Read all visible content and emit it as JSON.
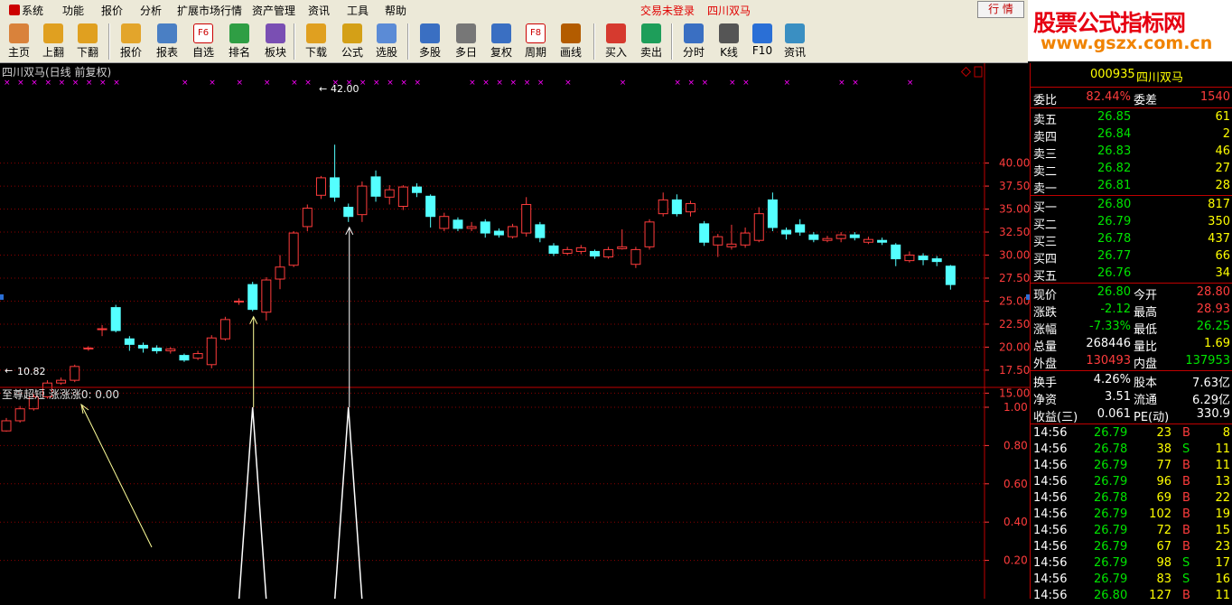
{
  "menu": {
    "items": [
      "系统",
      "功能",
      "报价",
      "分析",
      "扩展市场行情",
      "资产管理",
      "资讯",
      "工具",
      "帮助"
    ],
    "trade_status": "交易未登录",
    "stock_name": "四川双马",
    "hq_button": "行  情"
  },
  "watermark": {
    "line1": "股票公式指标网",
    "line2": "www.gszx.com.cn"
  },
  "toolbar": {
    "buttons": [
      {
        "label": "主页",
        "icon": "home-icon"
      },
      {
        "label": "上翻",
        "icon": "arrow-up-icon"
      },
      {
        "label": "下翻",
        "icon": "arrow-down-icon"
      },
      {
        "label": "报价",
        "icon": "yuan-icon"
      },
      {
        "label": "报表",
        "icon": "report-icon"
      },
      {
        "label": "自选",
        "icon": "f6-icon"
      },
      {
        "label": "排名",
        "icon": "rank-icon"
      },
      {
        "label": "板块",
        "icon": "blocks-icon"
      },
      {
        "label": "下载",
        "icon": "download-icon"
      },
      {
        "label": "公式",
        "icon": "formula-icon"
      },
      {
        "label": "选股",
        "icon": "select-stock-icon"
      },
      {
        "label": "多股",
        "icon": "multi-stock-icon"
      },
      {
        "label": "多日",
        "icon": "clock-icon"
      },
      {
        "label": "复权",
        "icon": "adjust-icon"
      },
      {
        "label": "周期",
        "icon": "f8-icon"
      },
      {
        "label": "画线",
        "icon": "pen-icon"
      },
      {
        "label": "买入",
        "icon": "buy-icon"
      },
      {
        "label": "卖出",
        "icon": "sell-icon"
      },
      {
        "label": "分时",
        "icon": "intraday-icon"
      },
      {
        "label": "K线",
        "icon": "kline-icon"
      },
      {
        "label": "F10",
        "icon": "f10-icon"
      },
      {
        "label": "资讯",
        "icon": "news-icon"
      }
    ],
    "f6_text": "F6",
    "f8_text": "F8"
  },
  "chart": {
    "title": "四川双马(日线 前复权)",
    "high_label": "42.00",
    "low_label": "10.82",
    "price_axis": [
      "40.00",
      "37.50",
      "35.00",
      "32.50",
      "30.00",
      "27.50",
      "25.00",
      "22.50",
      "20.00",
      "17.50",
      "15.00"
    ],
    "indicator_title": "至尊超短  涨涨涨0: 0.00",
    "indicator_axis": [
      "1.00",
      "0.80",
      "0.60",
      "0.40",
      "0.20"
    ],
    "colors": {
      "up": "#ff3c3c",
      "down": "#54ffff",
      "ma": "#ffffff",
      "grid": "#8b0000",
      "axis": "#ff3c3c",
      "marker": "#ff00ff"
    }
  },
  "chart_data": {
    "type": "candlestick",
    "title": "四川双马(日线 前复权)",
    "ylim": [
      10,
      42.5
    ],
    "candles": [
      {
        "o": 10.9,
        "c": 12.0,
        "h": 12.3,
        "l": 10.82
      },
      {
        "o": 12.0,
        "c": 13.3,
        "h": 13.6,
        "l": 11.8
      },
      {
        "o": 13.3,
        "c": 14.6,
        "h": 14.9,
        "l": 13.1
      },
      {
        "o": 14.6,
        "c": 16.1,
        "h": 16.4,
        "l": 14.4
      },
      {
        "o": 16.1,
        "c": 16.4,
        "h": 16.7,
        "l": 15.9
      },
      {
        "o": 16.4,
        "c": 17.9,
        "h": 18.1,
        "l": 16.2
      },
      {
        "o": 19.8,
        "c": 19.9,
        "h": 20.1,
        "l": 19.6
      },
      {
        "o": 21.9,
        "c": 22.0,
        "h": 22.4,
        "l": 21.2
      },
      {
        "o": 24.3,
        "c": 21.8,
        "h": 24.6,
        "l": 21.6
      },
      {
        "o": 20.9,
        "c": 20.3,
        "h": 21.2,
        "l": 19.6
      },
      {
        "o": 20.2,
        "c": 19.9,
        "h": 20.5,
        "l": 19.4
      },
      {
        "o": 19.9,
        "c": 19.6,
        "h": 20.2,
        "l": 19.3
      },
      {
        "o": 19.6,
        "c": 19.8,
        "h": 20.0,
        "l": 19.3
      },
      {
        "o": 19.1,
        "c": 18.6,
        "h": 19.3,
        "l": 18.4
      },
      {
        "o": 18.8,
        "c": 19.3,
        "h": 19.6,
        "l": 18.6
      },
      {
        "o": 18.1,
        "c": 21.0,
        "h": 21.3,
        "l": 17.7
      },
      {
        "o": 20.9,
        "c": 23.0,
        "h": 23.3,
        "l": 20.7
      },
      {
        "o": 24.9,
        "c": 25.0,
        "h": 25.3,
        "l": 24.6
      },
      {
        "o": 26.8,
        "c": 24.1,
        "h": 27.1,
        "l": 23.9
      },
      {
        "o": 23.8,
        "c": 27.3,
        "h": 27.6,
        "l": 22.9
      },
      {
        "o": 27.4,
        "c": 28.7,
        "h": 30.0,
        "l": 26.3
      },
      {
        "o": 28.9,
        "c": 32.4,
        "h": 32.6,
        "l": 28.7
      },
      {
        "o": 33.1,
        "c": 35.1,
        "h": 35.5,
        "l": 32.6
      },
      {
        "o": 36.5,
        "c": 38.4,
        "h": 38.6,
        "l": 36.1
      },
      {
        "o": 38.4,
        "c": 36.3,
        "h": 42.0,
        "l": 35.8
      },
      {
        "o": 35.2,
        "c": 34.2,
        "h": 35.6,
        "l": 33.6
      },
      {
        "o": 34.4,
        "c": 37.5,
        "h": 38.0,
        "l": 33.6
      },
      {
        "o": 38.5,
        "c": 36.4,
        "h": 39.2,
        "l": 35.8
      },
      {
        "o": 36.3,
        "c": 37.1,
        "h": 37.6,
        "l": 35.5
      },
      {
        "o": 35.3,
        "c": 37.4,
        "h": 37.6,
        "l": 34.9
      },
      {
        "o": 37.4,
        "c": 36.8,
        "h": 37.8,
        "l": 36.3
      },
      {
        "o": 36.4,
        "c": 34.2,
        "h": 36.6,
        "l": 33.0
      },
      {
        "o": 32.9,
        "c": 34.2,
        "h": 34.6,
        "l": 32.6
      },
      {
        "o": 33.8,
        "c": 32.9,
        "h": 34.1,
        "l": 32.6
      },
      {
        "o": 32.9,
        "c": 33.1,
        "h": 33.6,
        "l": 32.6
      },
      {
        "o": 33.6,
        "c": 32.4,
        "h": 33.9,
        "l": 31.9
      },
      {
        "o": 32.6,
        "c": 32.2,
        "h": 32.9,
        "l": 31.9
      },
      {
        "o": 32.0,
        "c": 33.1,
        "h": 33.4,
        "l": 31.8
      },
      {
        "o": 32.4,
        "c": 35.5,
        "h": 36.3,
        "l": 32.0
      },
      {
        "o": 33.3,
        "c": 31.9,
        "h": 33.6,
        "l": 31.4
      },
      {
        "o": 31.0,
        "c": 30.2,
        "h": 31.3,
        "l": 29.9
      },
      {
        "o": 30.2,
        "c": 30.6,
        "h": 30.9,
        "l": 30.0
      },
      {
        "o": 30.4,
        "c": 30.8,
        "h": 31.1,
        "l": 30.1
      },
      {
        "o": 30.4,
        "c": 29.9,
        "h": 30.6,
        "l": 29.6
      },
      {
        "o": 29.8,
        "c": 30.6,
        "h": 30.9,
        "l": 29.6
      },
      {
        "o": 30.7,
        "c": 30.9,
        "h": 32.8,
        "l": 30.6
      },
      {
        "o": 29.0,
        "c": 30.6,
        "h": 30.9,
        "l": 28.6
      },
      {
        "o": 30.9,
        "c": 33.6,
        "h": 33.9,
        "l": 30.6
      },
      {
        "o": 34.5,
        "c": 36.0,
        "h": 36.8,
        "l": 34.2
      },
      {
        "o": 36.0,
        "c": 34.5,
        "h": 36.6,
        "l": 34.2
      },
      {
        "o": 34.7,
        "c": 35.6,
        "h": 35.9,
        "l": 34.2
      },
      {
        "o": 33.4,
        "c": 31.4,
        "h": 33.7,
        "l": 31.0
      },
      {
        "o": 31.1,
        "c": 32.0,
        "h": 32.3,
        "l": 29.8
      },
      {
        "o": 30.9,
        "c": 31.2,
        "h": 33.3,
        "l": 30.6
      },
      {
        "o": 31.1,
        "c": 32.4,
        "h": 33.0,
        "l": 30.8
      },
      {
        "o": 31.6,
        "c": 34.5,
        "h": 35.2,
        "l": 31.4
      },
      {
        "o": 36.0,
        "c": 33.0,
        "h": 36.8,
        "l": 32.6
      },
      {
        "o": 32.7,
        "c": 32.3,
        "h": 33.0,
        "l": 31.7
      },
      {
        "o": 33.3,
        "c": 32.5,
        "h": 33.9,
        "l": 32.1
      },
      {
        "o": 32.2,
        "c": 31.7,
        "h": 32.5,
        "l": 31.4
      },
      {
        "o": 31.6,
        "c": 31.8,
        "h": 32.1,
        "l": 31.4
      },
      {
        "o": 31.8,
        "c": 32.2,
        "h": 32.5,
        "l": 31.4
      },
      {
        "o": 32.2,
        "c": 31.9,
        "h": 32.5,
        "l": 31.6
      },
      {
        "o": 31.4,
        "c": 31.7,
        "h": 32.0,
        "l": 31.2
      },
      {
        "o": 31.6,
        "c": 31.4,
        "h": 31.9,
        "l": 31.1
      },
      {
        "o": 31.1,
        "c": 29.6,
        "h": 31.3,
        "l": 28.8
      },
      {
        "o": 29.4,
        "c": 30.0,
        "h": 30.4,
        "l": 29.2
      },
      {
        "o": 29.9,
        "c": 29.5,
        "h": 30.2,
        "l": 28.9
      },
      {
        "o": 29.6,
        "c": 29.3,
        "h": 29.9,
        "l": 28.8
      },
      {
        "o": 28.8,
        "c": 26.8,
        "h": 28.93,
        "l": 26.25
      }
    ],
    "signal_days": [
      18,
      25
    ],
    "indicator_ylim": [
      0,
      1.05
    ],
    "indicator_values_at_signals": [
      1.0,
      1.0
    ]
  },
  "quote": {
    "code": "000935",
    "name": "四川双马",
    "weibi_label": "委比",
    "weibi": "82.44%",
    "weicha_label": "委差",
    "weicha": "1540",
    "asks": [
      {
        "label": "卖五",
        "price": "26.85",
        "vol": "61"
      },
      {
        "label": "卖四",
        "price": "26.84",
        "vol": "2"
      },
      {
        "label": "卖三",
        "price": "26.83",
        "vol": "46"
      },
      {
        "label": "卖二",
        "price": "26.82",
        "vol": "27"
      },
      {
        "label": "卖一",
        "price": "26.81",
        "vol": "28"
      }
    ],
    "bids": [
      {
        "label": "买一",
        "price": "26.80",
        "vol": "817"
      },
      {
        "label": "买二",
        "price": "26.79",
        "vol": "350"
      },
      {
        "label": "买三",
        "price": "26.78",
        "vol": "437"
      },
      {
        "label": "买四",
        "price": "26.77",
        "vol": "66"
      },
      {
        "label": "买五",
        "price": "26.76",
        "vol": "34"
      }
    ],
    "stats": [
      {
        "l1": "现价",
        "v1": "26.80",
        "c1": "green",
        "l2": "今开",
        "v2": "28.80",
        "c2": "red"
      },
      {
        "l1": "涨跌",
        "v1": "-2.12",
        "c1": "green",
        "l2": "最高",
        "v2": "28.93",
        "c2": "red"
      },
      {
        "l1": "涨幅",
        "v1": "-7.33%",
        "c1": "green",
        "l2": "最低",
        "v2": "26.25",
        "c2": "green"
      },
      {
        "l1": "总量",
        "v1": "268446",
        "c1": "white",
        "l2": "量比",
        "v2": "1.69",
        "c2": "yellow"
      },
      {
        "l1": "外盘",
        "v1": "130493",
        "c1": "red",
        "l2": "内盘",
        "v2": "137953",
        "c2": "green"
      }
    ],
    "fund": [
      {
        "l1": "换手",
        "v1": "4.26%",
        "l2": "股本",
        "v2": "7.63亿"
      },
      {
        "l1": "净资",
        "v1": "3.51",
        "l2": "流通",
        "v2": "6.29亿"
      },
      {
        "l1": "收益(三)",
        "v1": "0.061",
        "l2": "PE(动)",
        "v2": "330.9"
      }
    ],
    "ticks": [
      {
        "time": "14:56",
        "price": "26.79",
        "vol": "23",
        "bs": "B",
        "n": "8"
      },
      {
        "time": "14:56",
        "price": "26.78",
        "vol": "38",
        "bs": "S",
        "n": "11"
      },
      {
        "time": "14:56",
        "price": "26.79",
        "vol": "77",
        "bs": "B",
        "n": "11"
      },
      {
        "time": "14:56",
        "price": "26.79",
        "vol": "96",
        "bs": "B",
        "n": "13"
      },
      {
        "time": "14:56",
        "price": "26.78",
        "vol": "69",
        "bs": "B",
        "n": "22"
      },
      {
        "time": "14:56",
        "price": "26.79",
        "vol": "102",
        "bs": "B",
        "n": "19"
      },
      {
        "time": "14:56",
        "price": "26.79",
        "vol": "72",
        "bs": "B",
        "n": "15"
      },
      {
        "time": "14:56",
        "price": "26.79",
        "vol": "67",
        "bs": "B",
        "n": "23"
      },
      {
        "time": "14:56",
        "price": "26.79",
        "vol": "98",
        "bs": "S",
        "n": "17"
      },
      {
        "time": "14:56",
        "price": "26.79",
        "vol": "83",
        "bs": "S",
        "n": "16"
      },
      {
        "time": "14:56",
        "price": "26.80",
        "vol": "127",
        "bs": "B",
        "n": "11"
      }
    ]
  }
}
